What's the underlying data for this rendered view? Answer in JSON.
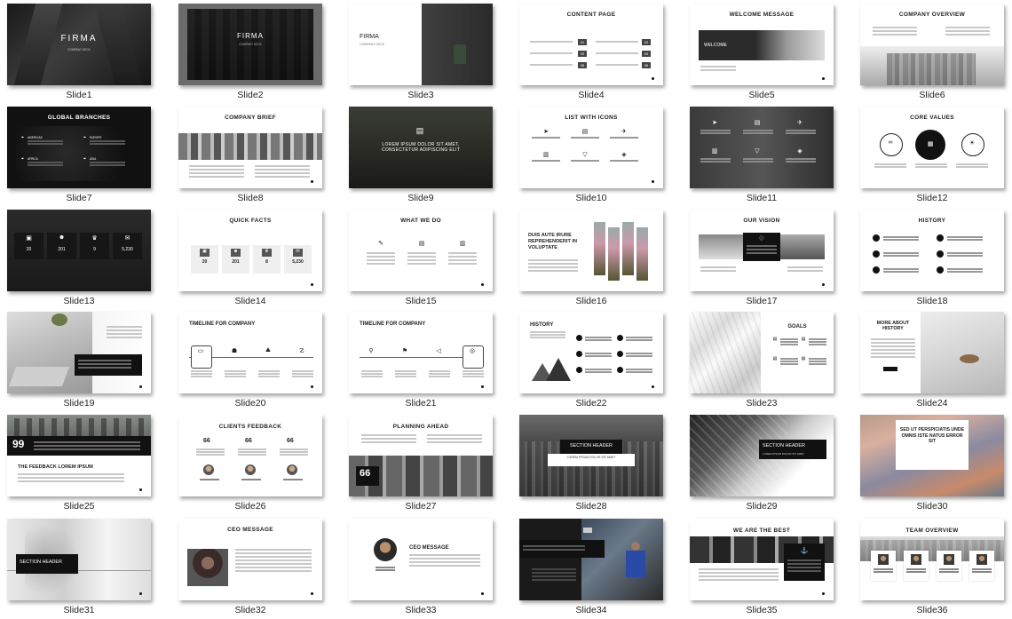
{
  "slides": [
    {
      "label": "Slide1",
      "kind": "title-dark",
      "text": "FIRMA",
      "sub": "COMPANY DECK"
    },
    {
      "label": "Slide2",
      "kind": "title-frame",
      "text": "FIRMA",
      "sub": "COMPANY DECK"
    },
    {
      "label": "Slide3",
      "kind": "title-white-box",
      "text": "FIRMA",
      "sub": "COMPANY DECK"
    },
    {
      "label": "Slide4",
      "kind": "content-page",
      "text": "CONTENT PAGE",
      "nums": [
        "01",
        "02",
        "03",
        "04",
        "05",
        "06"
      ]
    },
    {
      "label": "Slide5",
      "kind": "welcome",
      "text": "WELCOME MESSAGE",
      "sub": "WELCOME"
    },
    {
      "label": "Slide6",
      "kind": "overview",
      "text": "COMPANY OVERVIEW"
    },
    {
      "label": "Slide7",
      "kind": "branches",
      "text": "GLOBAL BRANCHES",
      "regions": [
        "AMERICAS",
        "EUROPE",
        "AFRICA",
        "ASIA"
      ]
    },
    {
      "label": "Slide8",
      "kind": "brief",
      "text": "COMPANY BRIEF"
    },
    {
      "label": "Slide9",
      "kind": "quote-photo",
      "text": "LOREM IPSUM DOLOR SIT AMET, CONSECTETUR ADIPISCING ELIT"
    },
    {
      "label": "Slide10",
      "kind": "icons-list",
      "text": "LIST WITH ICONS"
    },
    {
      "label": "Slide11",
      "kind": "icons-dark",
      "text": ""
    },
    {
      "label": "Slide12",
      "kind": "core-values",
      "text": "CORE VALUES"
    },
    {
      "label": "Slide13",
      "kind": "stats-dark",
      "nums": [
        "20",
        "201",
        "9",
        "5,230"
      ]
    },
    {
      "label": "Slide14",
      "kind": "quick-facts",
      "text": "QUICK FACTS",
      "nums": [
        "20",
        "201",
        "8",
        "5,230"
      ]
    },
    {
      "label": "Slide15",
      "kind": "what-we-do",
      "text": "WHAT WE DO"
    },
    {
      "label": "Slide16",
      "kind": "duis",
      "text": "DUIS AUTE IRURE REPREHENDERIT IN VOLUPTATE"
    },
    {
      "label": "Slide17",
      "kind": "vision",
      "text": "OUR VISION"
    },
    {
      "label": "Slide18",
      "kind": "history-list",
      "text": "HISTORY"
    },
    {
      "label": "Slide19",
      "kind": "desk-photo",
      "text": ""
    },
    {
      "label": "Slide20",
      "kind": "timeline1",
      "text": "TIMELINE FOR COMPANY"
    },
    {
      "label": "Slide21",
      "kind": "timeline2",
      "text": "TIMELINE FOR COMPANY"
    },
    {
      "label": "Slide22",
      "kind": "history-tri",
      "text": "HISTORY"
    },
    {
      "label": "Slide23",
      "kind": "goals",
      "text": "GOALS"
    },
    {
      "label": "Slide24",
      "kind": "more-history",
      "text": "MORE ABOUT HISTORY"
    },
    {
      "label": "Slide25",
      "kind": "feedback-lorem",
      "text": "THE FEEDBACK LOREM IPSUM"
    },
    {
      "label": "Slide26",
      "kind": "clients",
      "text": "CLIENTS FEEDBACK"
    },
    {
      "label": "Slide27",
      "kind": "planning",
      "text": "PLANNING AHEAD"
    },
    {
      "label": "Slide28",
      "kind": "section1",
      "text": "SECTION HEADER",
      "sub": "LOREM IPSUM DOLOR SIT AMET"
    },
    {
      "label": "Slide29",
      "kind": "section2",
      "text": "SECTION HEADER",
      "sub": "LOREM IPSUM DOLOR SIT AMET"
    },
    {
      "label": "Slide30",
      "kind": "sed-ut",
      "text": "SED UT PERSPICIATIS UNDE OMNIS ISTE NATUS ERROR SIT"
    },
    {
      "label": "Slide31",
      "kind": "section3",
      "text": "SECTION HEADER"
    },
    {
      "label": "Slide32",
      "kind": "ceo1",
      "text": "CEO MESSAGE"
    },
    {
      "label": "Slide33",
      "kind": "ceo2",
      "text": "CEO MESSAGE"
    },
    {
      "label": "Slide34",
      "kind": "photo-dark",
      "text": ""
    },
    {
      "label": "Slide35",
      "kind": "best",
      "text": "WE ARE THE BEST"
    },
    {
      "label": "Slide36",
      "kind": "team",
      "text": "TEAM OVERVIEW"
    }
  ],
  "colors": {
    "dark": "#1e1e1e",
    "mid": "#555555",
    "light": "#f2f2f2",
    "accent": "#111111"
  }
}
